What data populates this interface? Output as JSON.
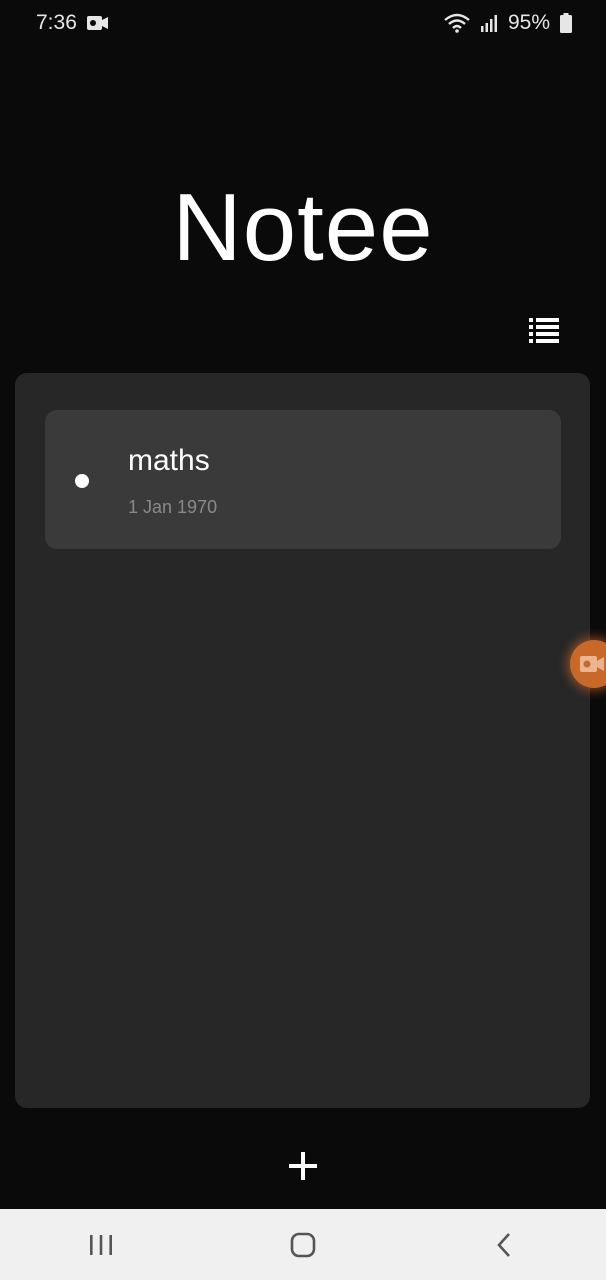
{
  "status_bar": {
    "time": "7:36",
    "battery": "95%",
    "icons": [
      "video-camera-icon",
      "wifi-icon",
      "signal-icon",
      "battery-icon"
    ]
  },
  "app": {
    "title": "Notee"
  },
  "toolbar": {
    "list_view_icon": "list-view-icon"
  },
  "notes": [
    {
      "title": "maths",
      "date": "1 Jan 1970"
    }
  ],
  "fab": {
    "icon": "plus-icon"
  },
  "floating_bubble": {
    "icon": "video-camera-icon",
    "color": "#c8692a"
  },
  "nav_bar": {
    "items": [
      "recents-icon",
      "home-icon",
      "back-icon"
    ]
  },
  "colors": {
    "background": "#0a0a0a",
    "panel": "#272727",
    "card": "#3a3a3a",
    "date_text": "#8a8a8a"
  }
}
